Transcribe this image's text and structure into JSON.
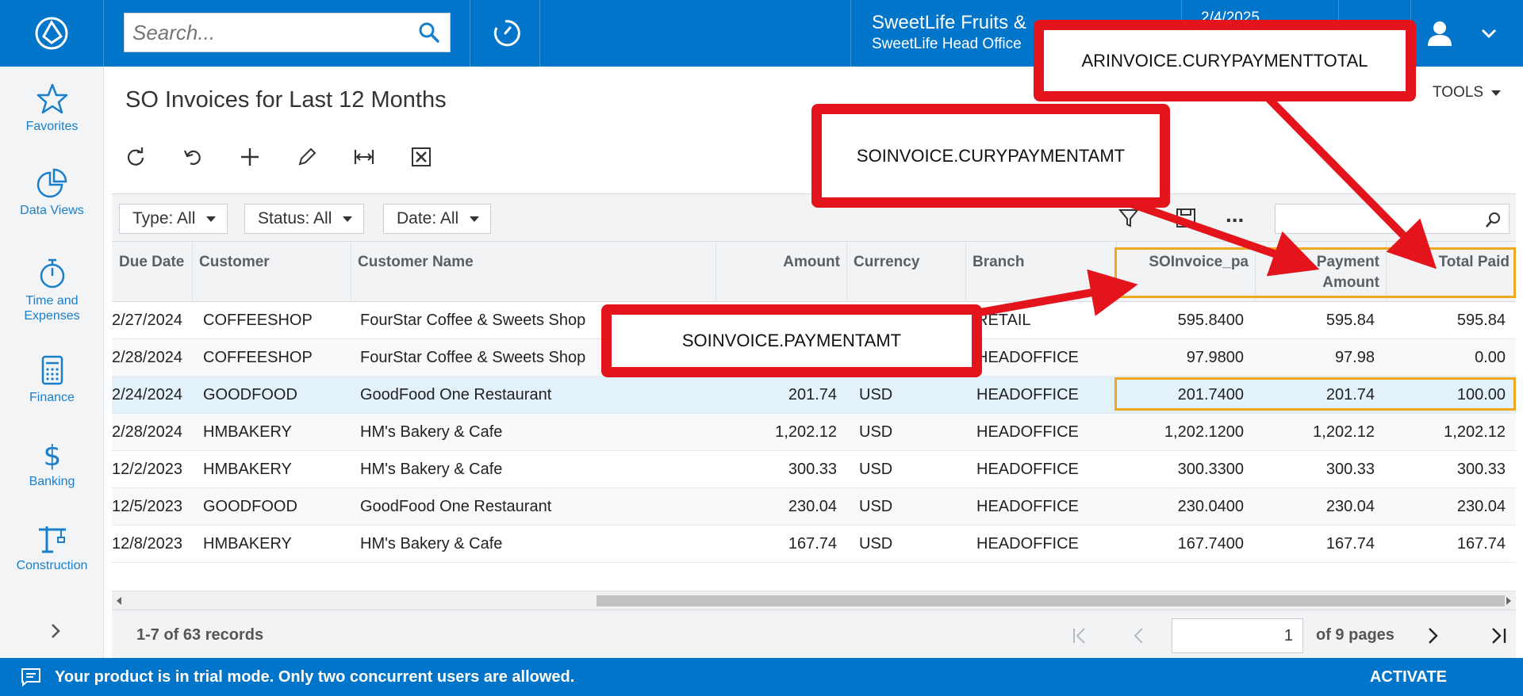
{
  "search": {
    "placeholder": "Search..."
  },
  "company": {
    "name": "SweetLife Fruits & ",
    "branch": "SweetLife Head Office",
    "date": "2/4/2025"
  },
  "sidebar": {
    "items": [
      {
        "label": "Favorites",
        "icon": "star-icon"
      },
      {
        "label": "Data Views",
        "icon": "pie-chart-icon"
      },
      {
        "label": "Time and Expenses",
        "icon": "stopwatch-icon"
      },
      {
        "label": "Finance",
        "icon": "calculator-icon"
      },
      {
        "label": "Banking",
        "icon": "dollar-icon"
      },
      {
        "label": "Construction",
        "icon": "crane-icon"
      }
    ]
  },
  "page": {
    "title": "SO Invoices for Last 12 Months",
    "tools_label": "TOOLS"
  },
  "filters": {
    "type": "Type: All",
    "status": "Status: All",
    "date": "Date: All",
    "more": "..."
  },
  "columns": {
    "due_date": "Due Date",
    "customer": "Customer",
    "customer_name": "Customer Name",
    "amount": "Amount",
    "currency": "Currency",
    "branch": "Branch",
    "soinvoice": "SOInvoice_pa",
    "payment_amount_1": "Payment",
    "payment_amount_2": "Amount",
    "total_paid": "Total Paid"
  },
  "rows": [
    {
      "due_date": "2/27/2024",
      "customer": "COFFEESHOP",
      "customer_name": "FourStar Coffee & Sweets Shop",
      "amount": "",
      "currency": "",
      "branch": "RETAIL",
      "soinvoice": "595.8400",
      "payment_amount": "595.84",
      "total_paid": "595.84"
    },
    {
      "due_date": "2/28/2024",
      "customer": "COFFEESHOP",
      "customer_name": "FourStar Coffee & Sweets Shop",
      "amount": "",
      "currency": "",
      "branch": "HEADOFFICE",
      "soinvoice": "97.9800",
      "payment_amount": "97.98",
      "total_paid": "0.00"
    },
    {
      "due_date": "2/24/2024",
      "customer": "GOODFOOD",
      "customer_name": "GoodFood One Restaurant",
      "amount": "201.74",
      "currency": "USD",
      "branch": "HEADOFFICE",
      "soinvoice": "201.7400",
      "payment_amount": "201.74",
      "total_paid": "100.00"
    },
    {
      "due_date": "2/28/2024",
      "customer": "HMBAKERY",
      "customer_name": "HM's Bakery & Cafe",
      "amount": "1,202.12",
      "currency": "USD",
      "branch": "HEADOFFICE",
      "soinvoice": "1,202.1200",
      "payment_amount": "1,202.12",
      "total_paid": "1,202.12"
    },
    {
      "due_date": "12/2/2023",
      "customer": "HMBAKERY",
      "customer_name": "HM's Bakery & Cafe",
      "amount": "300.33",
      "currency": "USD",
      "branch": "HEADOFFICE",
      "soinvoice": "300.3300",
      "payment_amount": "300.33",
      "total_paid": "300.33"
    },
    {
      "due_date": "12/5/2023",
      "customer": "GOODFOOD",
      "customer_name": "GoodFood One Restaurant",
      "amount": "230.04",
      "currency": "USD",
      "branch": "HEADOFFICE",
      "soinvoice": "230.0400",
      "payment_amount": "230.04",
      "total_paid": "230.04"
    },
    {
      "due_date": "12/8/2023",
      "customer": "HMBAKERY",
      "customer_name": "HM's Bakery & Cafe",
      "amount": "167.74",
      "currency": "USD",
      "branch": "HEADOFFICE",
      "soinvoice": "167.7400",
      "payment_amount": "167.74",
      "total_paid": "167.74"
    }
  ],
  "pager": {
    "records": "1-7 of 63 records",
    "page": "1",
    "of_pages": "of 9 pages"
  },
  "callouts": {
    "ar_total": "ARINVOICE.CURYPAYMENTTOTAL",
    "so_cury": "SOINVOICE.CURYPAYMENTAMT",
    "so_pay": "SOINVOICE.PAYMENTAMT"
  },
  "trial": {
    "message": "Your product is in trial mode. Only two concurrent users are allowed.",
    "activate": "ACTIVATE"
  },
  "colors": {
    "brand": "#0075c9",
    "callout": "#e3141c",
    "highlight": "#f0a91f",
    "selected_row": "#e3f1fa"
  }
}
